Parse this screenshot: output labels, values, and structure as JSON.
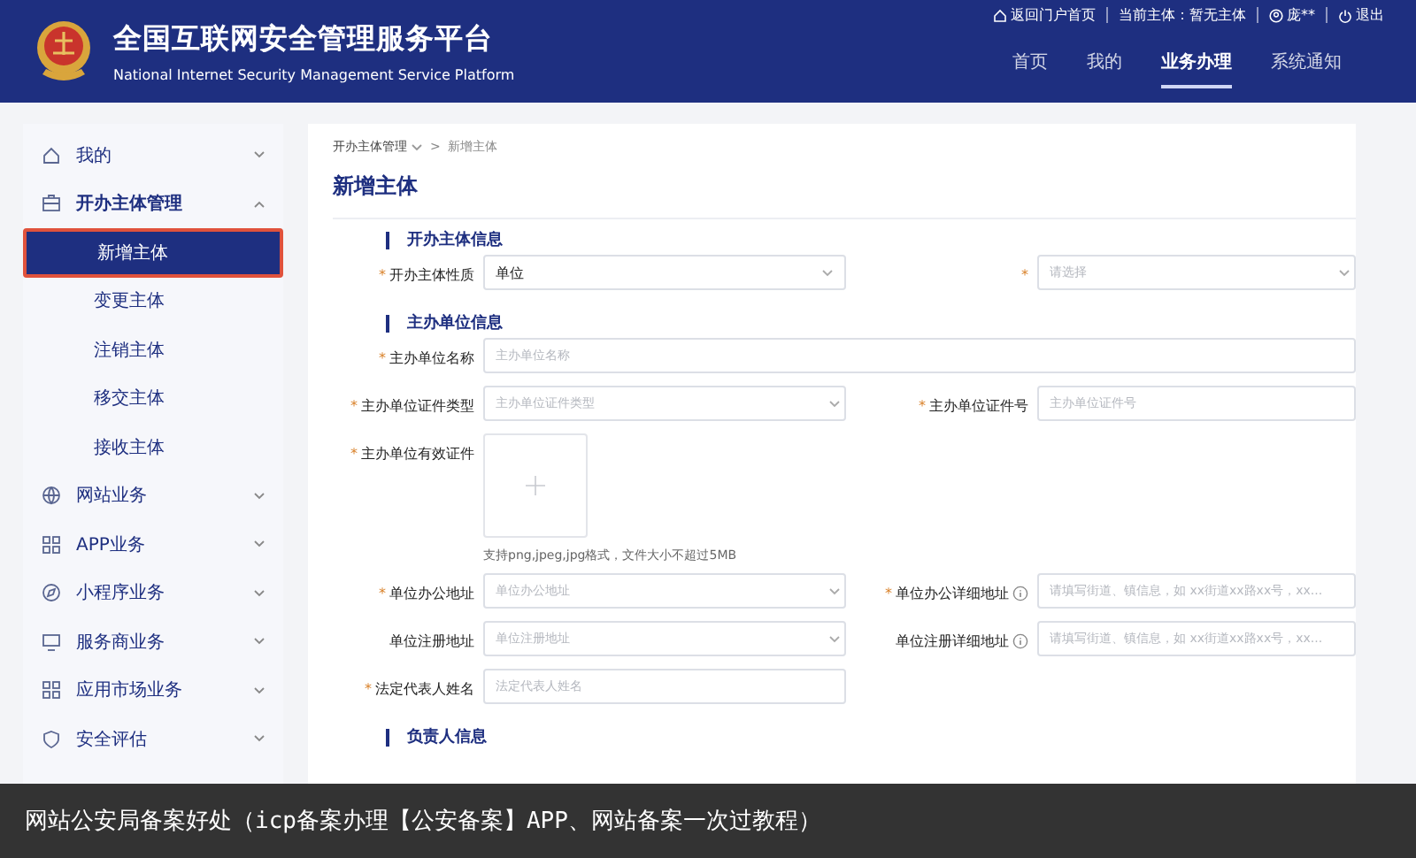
{
  "header": {
    "title": "全国互联网安全管理服务平台",
    "subtitle": "National Internet Security Management Service Platform",
    "top_links": [
      {
        "kind": "home",
        "label": "返回门户首页"
      },
      {
        "kind": "plain",
        "label": "当前主体：暂无主体"
      },
      {
        "kind": "user",
        "label": "庞**"
      },
      {
        "kind": "power",
        "label": "退出"
      }
    ],
    "nav": [
      {
        "label": "首页",
        "selected": false
      },
      {
        "label": "我的",
        "selected": false
      },
      {
        "label": "业务办理",
        "selected": true
      },
      {
        "label": "系统通知",
        "selected": false
      }
    ]
  },
  "sidebar": {
    "items": [
      {
        "label": "我的",
        "expanded": false
      },
      {
        "label": "开办主体管理",
        "expanded": true,
        "children": [
          {
            "label": "新增主体",
            "selected": true
          },
          {
            "label": "变更主体",
            "selected": false
          },
          {
            "label": "注销主体",
            "selected": false
          },
          {
            "label": "移交主体",
            "selected": false
          },
          {
            "label": "接收主体",
            "selected": false
          }
        ]
      },
      {
        "label": "网站业务",
        "expanded": false
      },
      {
        "label": "APP业务",
        "expanded": false
      },
      {
        "label": "小程序业务",
        "expanded": false
      },
      {
        "label": "服务商业务",
        "expanded": false
      },
      {
        "label": "应用市场业务",
        "expanded": false
      },
      {
        "label": "安全评估",
        "expanded": false
      }
    ]
  },
  "breadcrumb": {
    "items": [
      "开办主体管理",
      "新增主体"
    ],
    "separator": ">"
  },
  "page_title": "新增主体",
  "sections": [
    {
      "title": "开办主体信息",
      "rows": [
        {
          "fields": [
            {
              "kind": "select",
              "label": "开办主体性质",
              "mark": "*",
              "value": "单位"
            },
            {
              "kind": "select",
              "mark": "*",
              "placeholder": "请选择"
            }
          ]
        }
      ]
    },
    {
      "title": "主办单位信息",
      "rows": [
        {
          "fields": [
            {
              "kind": "input",
              "label": "主办单位名称",
              "mark": "*",
              "placeholder": "主办单位名称",
              "wide": true
            }
          ]
        },
        {
          "fields": [
            {
              "kind": "select",
              "label": "主办单位证件类型",
              "mark": "*",
              "placeholder": "主办单位证件类型"
            },
            {
              "kind": "input",
              "label": "主办单位证件号",
              "mark": "*",
              "placeholder": "主办单位证件号"
            }
          ]
        },
        {
          "fields": [
            {
              "kind": "upload",
              "label": "主办单位有效证件",
              "mark": "*",
              "hint": "支持png,jpeg,jpg格式，文件大小不超过5MB"
            }
          ]
        },
        {
          "fields": [
            {
              "kind": "select",
              "label": "单位办公地址",
              "mark": "*",
              "placeholder": "单位办公地址"
            },
            {
              "kind": "input",
              "label": "单位办公详细地址",
              "mark": "*",
              "info": true,
              "placeholder": "请填写街道、镇信息，如 xx街道xx路xx号，xx..."
            }
          ]
        },
        {
          "fields": [
            {
              "kind": "select",
              "label": "单位注册地址",
              "placeholder": "单位注册地址"
            },
            {
              "kind": "input",
              "label": "单位注册详细地址",
              "info": true,
              "placeholder": "请填写街道、镇信息，如 xx街道xx路xx号，xx..."
            }
          ]
        },
        {
          "fields": [
            {
              "kind": "input",
              "label": "法定代表人姓名",
              "mark": "*",
              "placeholder": "法定代表人姓名"
            }
          ]
        }
      ]
    },
    {
      "title": "负责人信息"
    }
  ],
  "caption": {
    "text": "网站公安局备案好处（icp备案办理【公安备案】APP、网站备案一次过教程）"
  }
}
